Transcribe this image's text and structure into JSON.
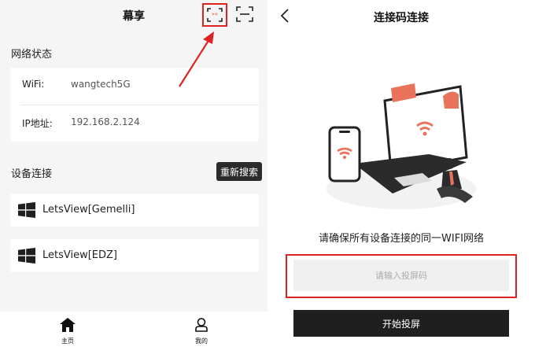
{
  "left": {
    "title": "幕享",
    "network_section": "网络状态",
    "wifi": {
      "label": "WiFi:",
      "value": "wangtech5G"
    },
    "ip": {
      "label": "IP地址:",
      "value": "192.168.2.124"
    },
    "devices_section": "设备连接",
    "refresh_label": "重新搜索",
    "devices": [
      {
        "name": "LetsView[Gemelli]"
      },
      {
        "name": "LetsView[EDZ]"
      }
    ],
    "tabs": [
      {
        "label": "主页"
      },
      {
        "label": "我的"
      }
    ]
  },
  "right": {
    "title": "连接码连接",
    "hint": "请确保所有设备连接的同一WIFI网络",
    "input_placeholder": "请输入投屏码",
    "start_label": "开始投屏"
  },
  "colors": {
    "highlight_red": "#dd2222",
    "accent_orange": "#e8735a",
    "dark": "#1f1f1f"
  }
}
